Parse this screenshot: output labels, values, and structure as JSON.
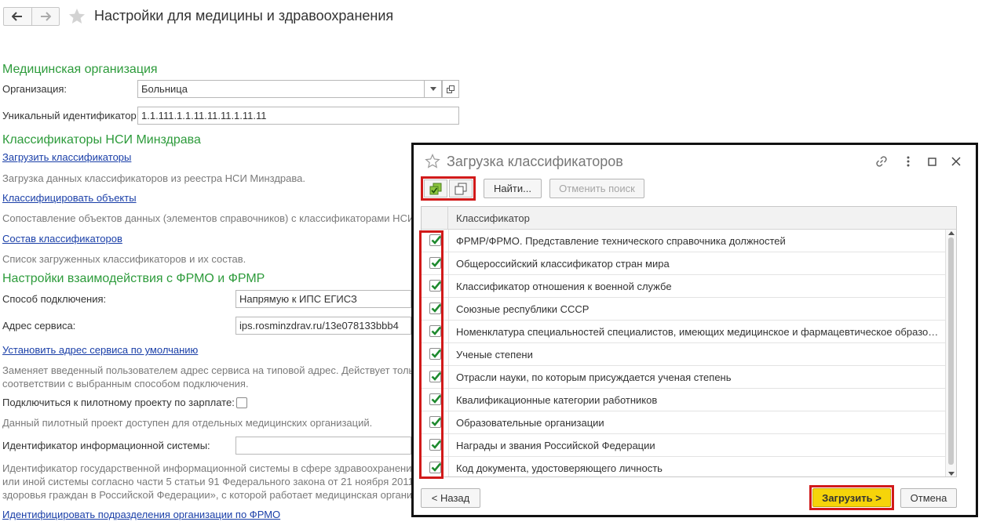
{
  "page": {
    "title": "Настройки для медицины и здравоохранения"
  },
  "section_org": {
    "title": "Медицинская организация",
    "org_label": "Организация:",
    "org_value": "Больница",
    "uid_label": "Уникальный идентификатор:",
    "uid_value": "1.1.111.1.1.11.11.11.1.11.11"
  },
  "section_nsi": {
    "title": "Классификаторы НСИ Минздрава",
    "load_link": "Загрузить классификаторы",
    "load_hint": "Загрузка данных классификаторов из реестра НСИ Минздрава.",
    "classify_link": "Классифицировать объекты",
    "classify_hint": "Сопоставление объектов данных (элементов справочников) с классификаторами НСИ",
    "composition_link": "Состав классификаторов",
    "composition_hint": "Список загруженных классификаторов и их состав."
  },
  "section_frmo": {
    "title": "Настройки взаимодействия с ФРМО и ФРМР",
    "conn_label": "Способ подключения:",
    "conn_value": "Напрямую к ИПС ЕГИСЗ",
    "addr_label": "Адрес сервиса:",
    "addr_value": "ips.rosminzdrav.ru/13e078133bbb4",
    "default_addr_link": "Установить адрес сервиса по умолчанию",
    "default_addr_hint_1": "Заменяет введенный пользователем адрес сервиса на типовой адрес. Действует толь",
    "default_addr_hint_2": "соответствии с выбранным способом подключения.",
    "pilot_label": "Подключиться к пилотному проекту по зарплате:",
    "pilot_hint": "Данный пилотный проект доступен для отдельных медицинских организаций.",
    "is_id_label": "Идентификатор информационной системы:",
    "is_id_value": "",
    "is_hint_1": "Идентификатор государственной информационной системы в сфере здравоохранения",
    "is_hint_2": "или иной системы согласно части 5 статьи 91 Федерального закона от 21 ноября 2011",
    "is_hint_3": "здоровья граждан в Российской Федерации», с которой работает медицинская органи",
    "identify_link": "Идентифицировать подразделения организации по ФРМО"
  },
  "dialog": {
    "title": "Загрузка классификаторов",
    "find_button": "Найти...",
    "cancel_search_button": "Отменить поиск",
    "column_header": "Классификатор",
    "rows": [
      {
        "checked": true,
        "label": "ФРМР/ФРМО. Представление технического справочника должностей"
      },
      {
        "checked": true,
        "label": "Общероссийский классификатор стран мира"
      },
      {
        "checked": true,
        "label": "Классификатор отношения к военной службе"
      },
      {
        "checked": true,
        "label": "Союзные республики СССР"
      },
      {
        "checked": true,
        "label": "Номенклатура специальностей специалистов, имеющих медицинское и фармацевтическое образов..."
      },
      {
        "checked": true,
        "label": "Ученые степени"
      },
      {
        "checked": true,
        "label": "Отрасли науки, по которым присуждается ученая степень"
      },
      {
        "checked": true,
        "label": "Квалификационные категории работников"
      },
      {
        "checked": true,
        "label": "Образовательные организации"
      },
      {
        "checked": true,
        "label": "Награды и звания Российской Федерации"
      },
      {
        "checked": true,
        "label": "Код документа, удостоверяющего личность"
      }
    ],
    "back_button": "< Назад",
    "load_button": "Загрузить >",
    "close_button": "Отмена"
  },
  "colors": {
    "section_green": "#2d9b3b",
    "link_blue": "#1a3fa8",
    "highlight_red": "#d11a1a",
    "primary_yellow": "#f6d40a",
    "check_green": "#1e8a2e"
  }
}
